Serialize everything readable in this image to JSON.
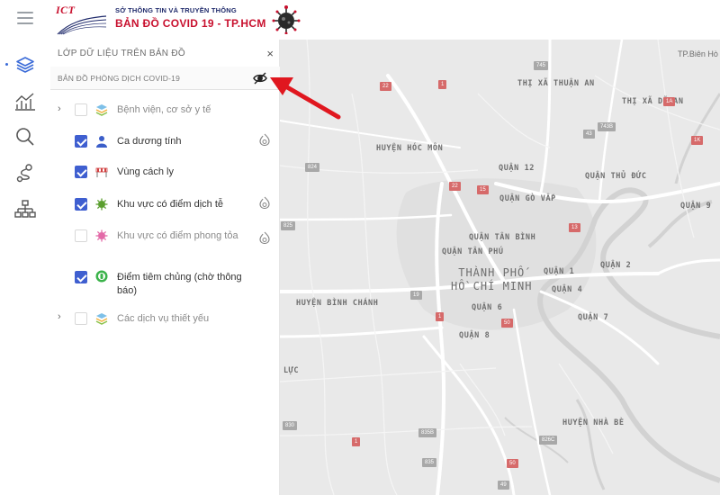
{
  "header": {
    "logo_ict": "ICT",
    "logo_subtitle": "SỞ THÔNG TIN VÀ TRUYỀN THÔNG",
    "logo_title": "BẢN ĐỒ  COVID 19 - TP.HCM"
  },
  "rail": {
    "items": [
      "layers-icon",
      "chart-icon",
      "search-icon",
      "route-icon",
      "hierarchy-icon"
    ]
  },
  "panel": {
    "title": "LỚP DỮ LIỆU TRÊN BẢN ĐỒ",
    "close": "×",
    "section_title": "BẢN ĐỒ PHÒNG DỊCH COVID-19",
    "layers": [
      {
        "label": "Bệnh viện, cơ sở y tế",
        "checked": false,
        "expandable": true,
        "muted": true
      },
      {
        "label": "Ca dương tính",
        "checked": true,
        "heatmap": true
      },
      {
        "label": "Vùng cách ly",
        "checked": true
      },
      {
        "label": "Khu vực có điểm dịch tễ",
        "checked": true,
        "heatmap": true
      },
      {
        "label": "Khu vực có điểm phong tỏa",
        "checked": false,
        "heatmap": true,
        "muted": true
      },
      {
        "label": "Điểm tiêm chủng (chờ thông báo)",
        "checked": true
      },
      {
        "label": "Các dịch vụ thiết yếu",
        "checked": false,
        "expandable": true,
        "muted": true
      }
    ]
  },
  "map": {
    "labels": {
      "thuan_an": "THỊ XÃ THUẬN AN",
      "di_an": "THỊ XÃ DĨ AN",
      "hoc_mon": "HUYỆN HÓC MÔN",
      "quan12": "QUẬN 12",
      "thu_duc": "QUẬN THỦ ĐỨC",
      "go_vap": "QUẬN GÒ VẤP",
      "quan9": "QUẬN 9",
      "tan_binh": "QUẬN TÂN BÌNH",
      "tan_phu": "QUẬN TÂN PHÚ",
      "city_line1": "THÀNH PHỐ",
      "city_line2": "HỒ CHÍ MINH",
      "quan1": "QUẬN 1",
      "quan2": "QUẬN 2",
      "quan4": "QUẬN 4",
      "binh_chanh": "HUYỆN BÌNH CHÁNH",
      "quan6": "QUẬN 6",
      "quan7": "QUẬN 7",
      "quan8": "QUẬN 8",
      "luc": "LỰC",
      "nha_be": "HUYỆN NHÀ BÈ",
      "bien_hoa": "TP.Biên Hò"
    },
    "shields": [
      {
        "text": "745",
        "color": "gray"
      },
      {
        "text": "22",
        "color": "red"
      },
      {
        "text": "1",
        "color": "red"
      },
      {
        "text": "1A",
        "color": "red"
      },
      {
        "text": "743B",
        "color": "gray"
      },
      {
        "text": "43",
        "color": "gray"
      },
      {
        "text": "1K",
        "color": "red"
      },
      {
        "text": "824",
        "color": "gray"
      },
      {
        "text": "22",
        "color": "red"
      },
      {
        "text": "15",
        "color": "red"
      },
      {
        "text": "13",
        "color": "red"
      },
      {
        "text": "825",
        "color": "gray"
      },
      {
        "text": "19",
        "color": "gray"
      },
      {
        "text": "1",
        "color": "red"
      },
      {
        "text": "50",
        "color": "red"
      },
      {
        "text": "830",
        "color": "gray"
      },
      {
        "text": "1",
        "color": "red"
      },
      {
        "text": "835B",
        "color": "gray"
      },
      {
        "text": "826C",
        "color": "gray"
      },
      {
        "text": "835",
        "color": "gray"
      },
      {
        "text": "50",
        "color": "red"
      },
      {
        "text": "49",
        "color": "gray"
      }
    ]
  },
  "colors": {
    "accent": "#3f5fd0",
    "brand_red": "#c8102e",
    "brand_navy": "#1f2a6b",
    "arrow": "#e0171f"
  }
}
